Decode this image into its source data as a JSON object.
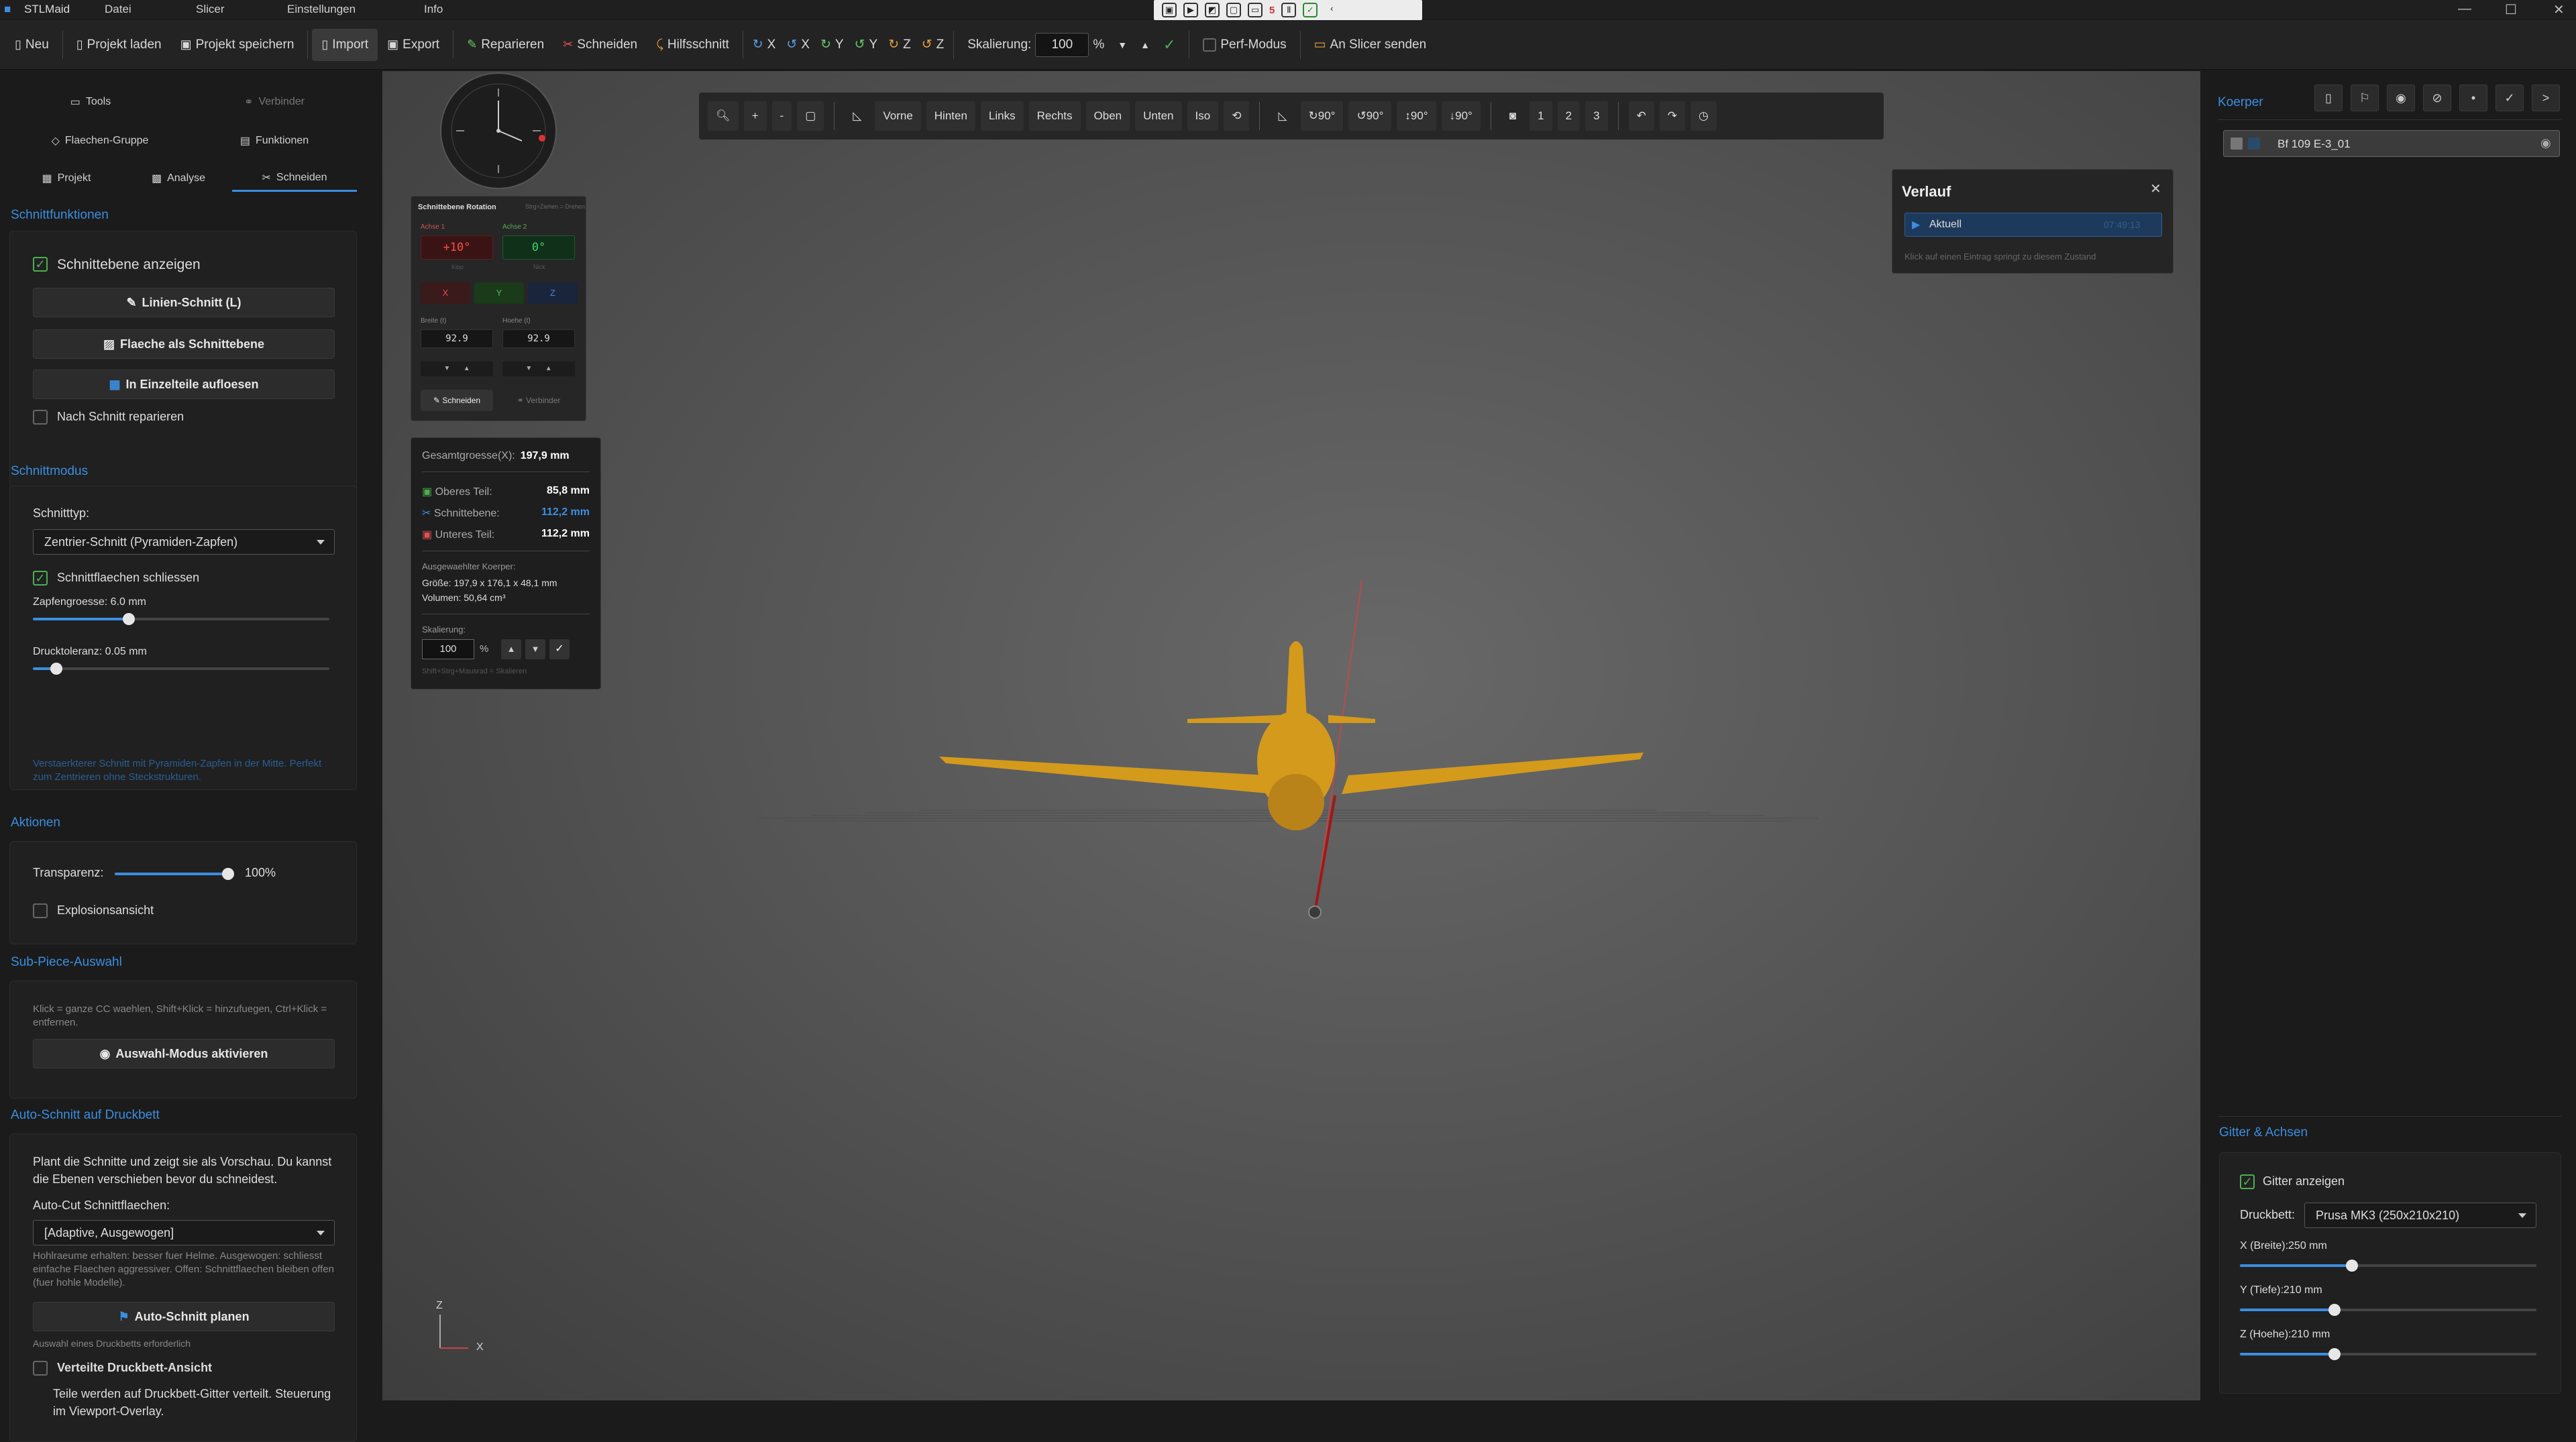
{
  "app": {
    "name": "STLMaid"
  },
  "menu": [
    "Datei",
    "Slicer",
    "Einstellungen",
    "Info"
  ],
  "qat": {
    "count": "5"
  },
  "toolbar": {
    "new": "Neu",
    "load": "Projekt laden",
    "save": "Projekt speichern",
    "import": "Import",
    "export": "Export",
    "repair": "Reparieren",
    "cut": "Schneiden",
    "helpcut": "Hilfsschnitt",
    "rot": [
      "X",
      "X",
      "Y",
      "Y",
      "Z",
      "Z"
    ],
    "scale_label": "Skalierung:",
    "scale_value": "100",
    "scale_unit": "%",
    "perf": "Perf-Modus",
    "slicer": "An Slicer senden"
  },
  "left": {
    "tabs": [
      "Tools",
      "Verbinder",
      "Flaechen-Gruppe",
      "Funktionen",
      "Projekt",
      "Analyse",
      "Schneiden"
    ],
    "sections": {
      "functions": "Schnittfunktionen",
      "mode": "Schnittmodus",
      "actions": "Aktionen",
      "subpiece": "Sub-Piece-Auswahl",
      "autocut": "Auto-Schnitt auf Druckbett"
    },
    "show_plane": "Schnittebene anzeigen",
    "line_cut": "Linien-Schnitt (L)",
    "face_plane": "Flaeche als Schnittebene",
    "split_parts": "In Einzelteile aufloesen",
    "repair_after": "Nach Schnitt reparieren",
    "cut_type_label": "Schnitttyp:",
    "cut_type": "Zentrier-Schnitt (Pyramiden-Zapfen)",
    "close_faces": "Schnittflaechen schliessen",
    "peg_size": "Zapfengroesse: 6.0 mm",
    "peg_size_value": 6.0,
    "tolerance": "Drucktoleranz: 0.05 mm",
    "tolerance_value": 0.05,
    "mode_hint": "Verstaerkterer Schnitt mit Pyramiden-Zapfen in der Mitte. Perfekt zum Zentrieren ohne Steckstrukturen.",
    "transparency_label": "Transparenz:",
    "transparency": "100%",
    "transparency_value": 100,
    "explode": "Explosionsansicht",
    "subpiece_hint": "Klick = ganze CC waehlen, Shift+Klick = hinzufuegen, Ctrl+Klick = entfernen.",
    "select_mode": "Auswahl-Modus aktivieren",
    "autocut_desc": "Plant die Schnitte und zeigt sie als Vorschau. Du kannst die Ebenen verschieben bevor du schneidest.",
    "autocut_faces_label": "Auto-Cut Schnittflaechen:",
    "autocut_faces": "[Adaptive, Ausgewogen]",
    "autocut_hint": "Hohlraeume erhalten: besser fuer Helme. Ausgewogen: schliesst einfache Flaechen aggressiver. Offen: Schnittflaechen bleiben offen (fuer hohle Modelle).",
    "plan_btn": "Auto-Schnitt planen",
    "need_bed": "Auswahl eines Druckbetts erforderlich",
    "bed_view": "Verteilte Druckbett-Ansicht",
    "bed_view_desc": "Teile werden auf Druckbett-Gitter verteilt. Steuerung im Viewport-Overlay."
  },
  "viewport": {
    "tools": [
      "Vorne",
      "Hinten",
      "Links",
      "Rechts",
      "Oben",
      "Unten",
      "Iso"
    ],
    "rot_btns": [
      "↻90°",
      "↺90°",
      "↕90°",
      "↓90°"
    ],
    "slots": [
      "1",
      "2",
      "3"
    ],
    "axis": {
      "z": "Z",
      "x": "X"
    }
  },
  "rotation": {
    "title": "Schnittebene Rotation",
    "hint": "Strg+Ziehen = Drehen",
    "axis1": "Achse 1",
    "axis2": "Achse 2",
    "a1": "+10°",
    "a2": "0°",
    "a1_unit": "Kipp",
    "a2_unit": "Nick",
    "btn_x": "X",
    "btn_y": "Y",
    "btn_z": "Z",
    "w_label": "Breite (t)",
    "h_label": "Hoehe (t)",
    "w": "92.9",
    "h": "92.9",
    "cut": "Schneiden",
    "connect": "Verbinder"
  },
  "sizes": {
    "total_label": "Gesamtgroesse(X):",
    "total": "197,9 mm",
    "upper_label": "Oberes Teil:",
    "upper": "85,8 mm",
    "plane_label": "Schnittebene:",
    "plane": "112,2 mm",
    "lower_label": "Unteres Teil:",
    "lower": "112,2 mm",
    "sel_label": "Ausgewaehlter Koerper:",
    "sel_size": "Größe: 197,9 x 176,1 x 48,1 mm",
    "sel_volume": "Volumen: 50,64 cm³",
    "scale_label": "Skalierung:",
    "scale": "100",
    "scale_unit": "%",
    "scale_hint": "Shift+Strg+Mausrad = Skalieren"
  },
  "history": {
    "title": "Verlauf",
    "entry": "Aktuell",
    "entry_time": "07:49:13",
    "hint": "Klick auf einen Eintrag springt zu diesem Zustand"
  },
  "right": {
    "title": "Koerper",
    "body": "Bf 109 E-3_01",
    "grid_section": "Gitter & Achsen",
    "show_grid": "Gitter anzeigen",
    "bed_label": "Druckbett:",
    "bed": "Prusa MK3 (250x210x210)",
    "x_label": "X (Breite):250 mm",
    "y_label": "Y (Tiefe):210 mm",
    "z_label": "Z (Hoehe):210 mm",
    "x_value": 250,
    "y_value": 210,
    "z_value": 210
  },
  "colors": {
    "accent": "#3b8ee0",
    "model": "#d49a1c",
    "check": "#4caf50"
  }
}
